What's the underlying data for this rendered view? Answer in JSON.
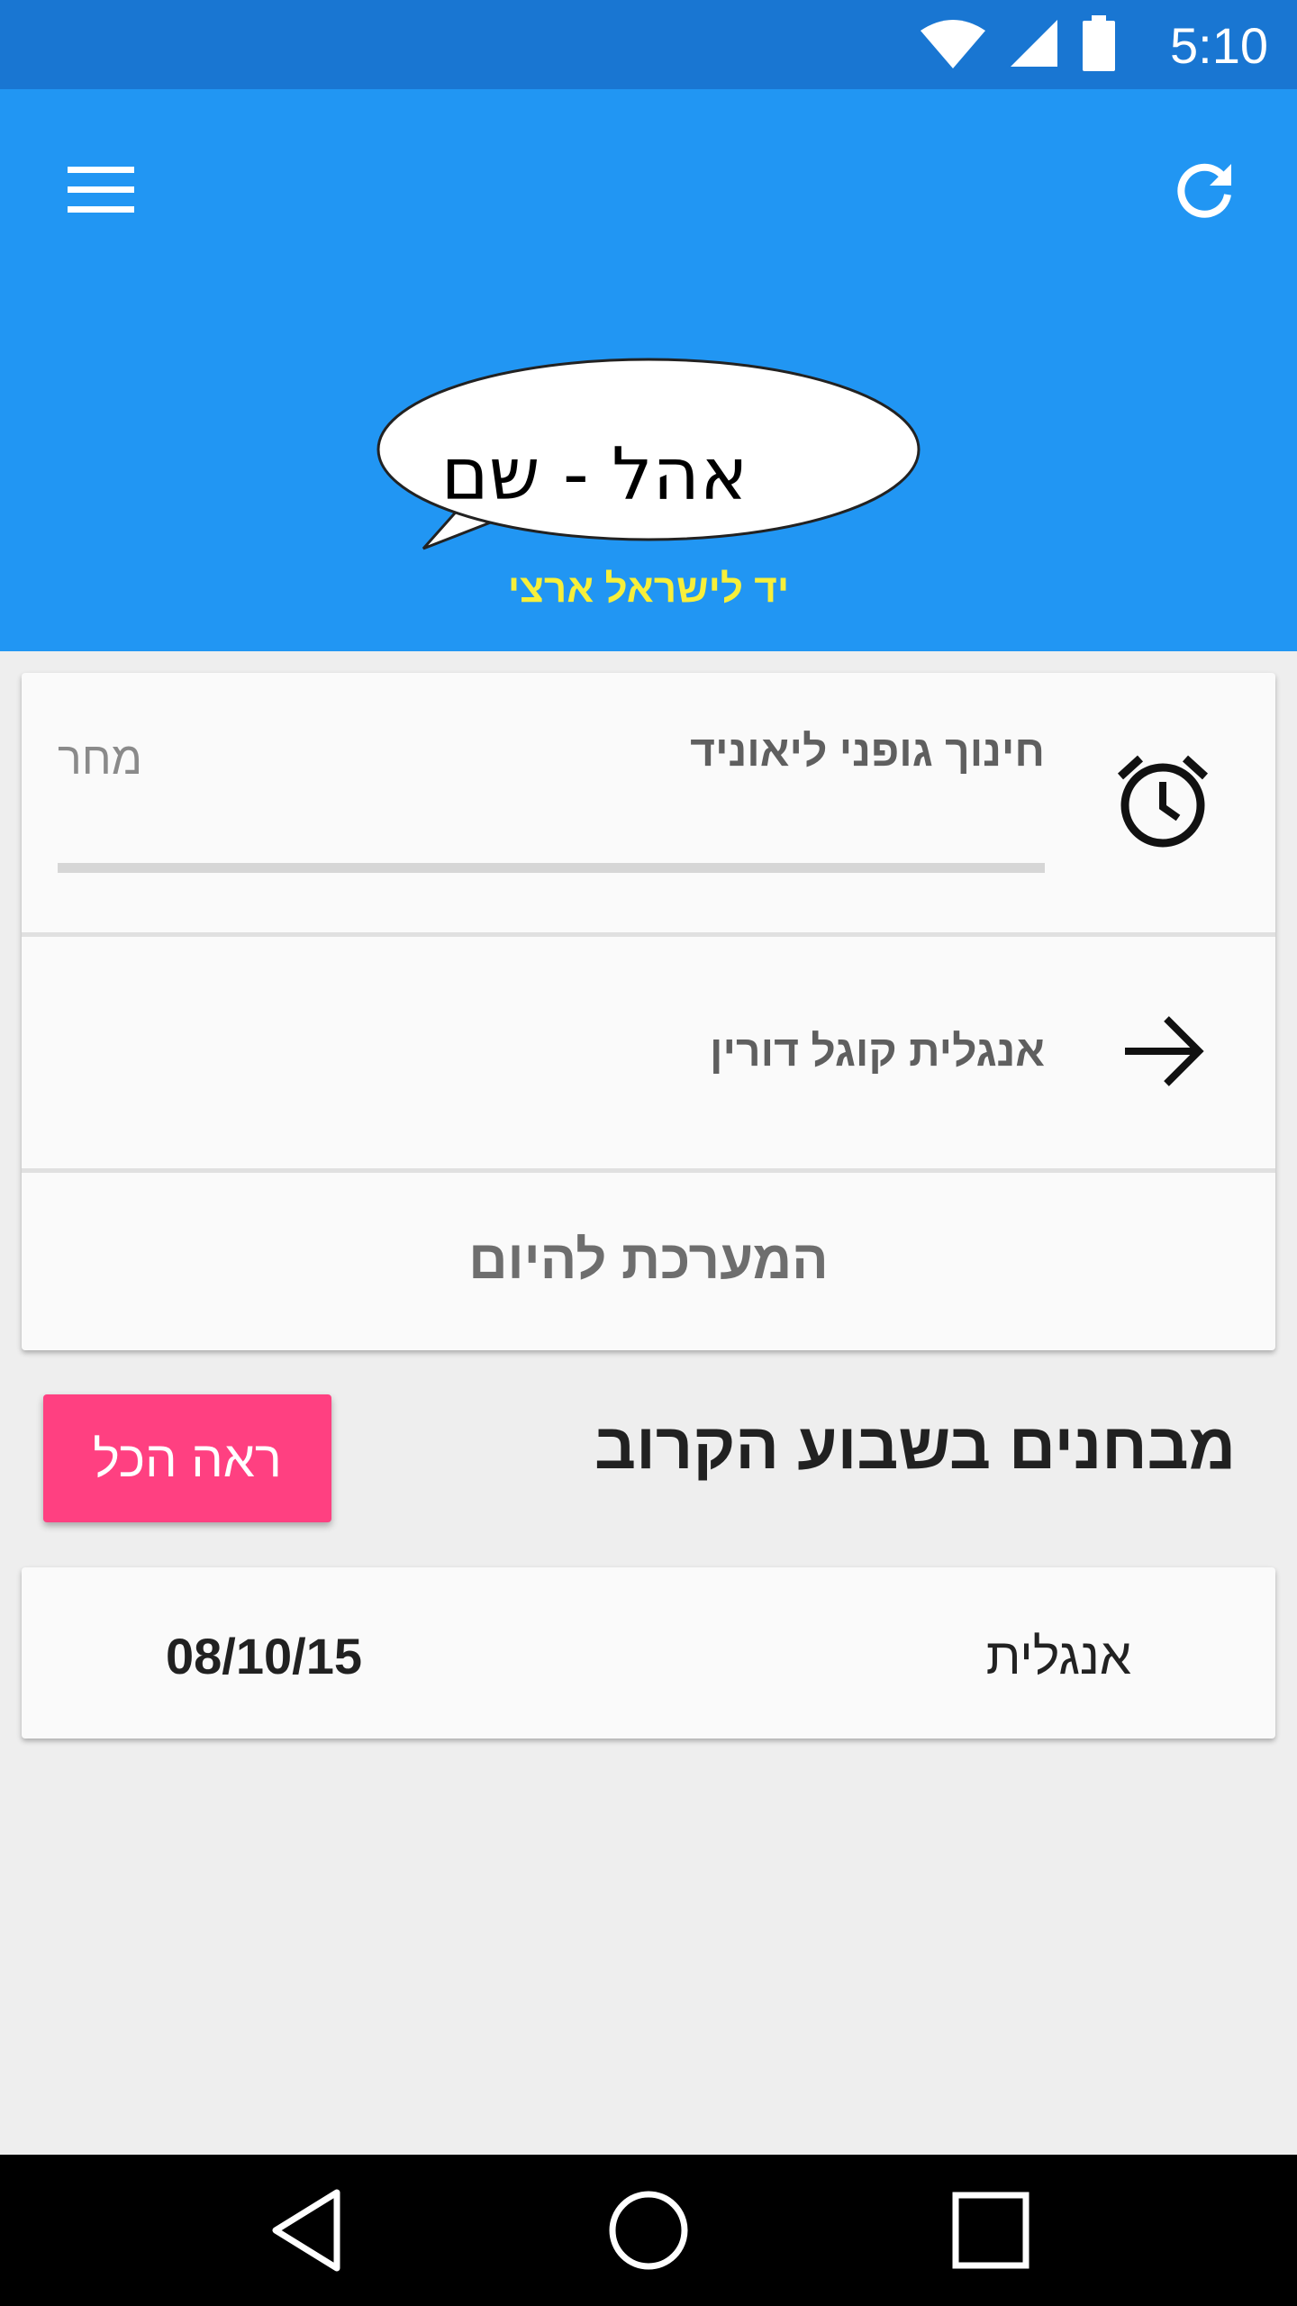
{
  "status_bar": {
    "time": "5:10",
    "icons": [
      "wifi-icon",
      "signal-icon",
      "battery-icon"
    ]
  },
  "app_bar": {
    "menu_icon": "menu-icon",
    "refresh_icon": "refresh-icon",
    "logo_text": "אהל - שם",
    "logo_tagline": "יד לישראל ארצי"
  },
  "today_card": {
    "current_lesson": "חינוך גופני ליאוניד",
    "next_label": "מחר",
    "current_icon": "alarm-clock-icon",
    "next_lesson": "אנגלית קוגל דורין",
    "next_icon": "arrow-forward-icon",
    "title": "המערכת להיום"
  },
  "exams_section": {
    "title": "מבחנים בשבוע הקרוב",
    "see_all_label": "ראה הכל",
    "items": [
      {
        "subject": "אנגלית",
        "date": "08/10/15"
      }
    ]
  },
  "nav_bar": {
    "back_icon": "back-triangle-icon",
    "home_icon": "home-circle-icon",
    "recents_icon": "recents-square-icon"
  },
  "colors": {
    "status_bar": "#1976d2",
    "app_bar": "#2196f3",
    "accent": "#ff4081",
    "tagline": "#f7ef3a"
  }
}
